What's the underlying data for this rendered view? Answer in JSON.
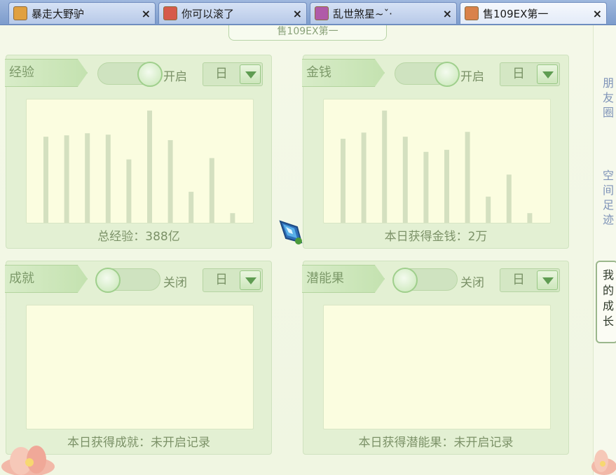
{
  "tabs": [
    {
      "name": "暴走大野驴",
      "close": "×",
      "active": false,
      "avatar_color": "#e0a040"
    },
    {
      "name": "你可以滚了",
      "close": "×",
      "active": false,
      "avatar_color": "#d65a4a"
    },
    {
      "name": "乱世煞星~ˇ·",
      "close": "×",
      "active": false,
      "avatar_color": "#b05aa8"
    },
    {
      "name": "售109EX第一",
      "close": "×",
      "active": true,
      "avatar_color": "#d9824a"
    }
  ],
  "page_title": "售109EX第一",
  "panels": {
    "experience": {
      "label": "经验",
      "switch_state": "on",
      "switch_text": "开启",
      "period": "日",
      "footer": "总经验：388亿",
      "chart_data": {
        "type": "bar",
        "values": [
          125,
          127,
          130,
          128,
          92,
          163,
          120,
          45,
          94,
          14
        ],
        "ylim": [
          0,
          175
        ]
      }
    },
    "money": {
      "label": "金钱",
      "switch_state": "on",
      "switch_text": "开启",
      "period": "日",
      "footer": "本日获得金钱：2万",
      "chart_data": {
        "type": "bar",
        "values": [
          122,
          131,
          163,
          125,
          103,
          106,
          132,
          38,
          70,
          14
        ],
        "ylim": [
          0,
          175
        ]
      }
    },
    "achievement": {
      "label": "成就",
      "switch_state": "off",
      "switch_text": "关闭",
      "period": "日",
      "footer": "本日获得成就：未开启记录"
    },
    "potential": {
      "label": "潜能果",
      "switch_state": "off",
      "switch_text": "关闭",
      "period": "日",
      "footer": "本日获得潜能果：未开启记录"
    }
  },
  "side": {
    "friends": "朋\n友\n圈",
    "space": "空\n间\n足\n迹",
    "growth": "我\n的\n成\n长"
  },
  "colors": {
    "bar": "#d4e0c0",
    "panel_bg": "#e3f0d3",
    "chart_bg": "#fbfde0"
  }
}
